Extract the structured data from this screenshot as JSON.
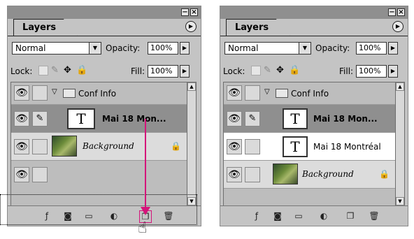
{
  "panels": [
    {
      "tab_label": "Layers",
      "blend_mode": "Normal",
      "opacity_label": "Opacity:",
      "opacity_value": "100%",
      "lock_label": "Lock:",
      "fill_label": "Fill:",
      "fill_value": "100%",
      "layers": [
        {
          "name": "Conf Info",
          "type": "group"
        },
        {
          "name": "Mai 18 Mon...",
          "type": "text",
          "selected": true
        },
        {
          "name": "Background",
          "type": "image",
          "locked": true
        },
        {
          "name": "",
          "type": "empty"
        }
      ]
    },
    {
      "tab_label": "Layers",
      "blend_mode": "Normal",
      "opacity_label": "Opacity:",
      "opacity_value": "100%",
      "lock_label": "Lock:",
      "fill_label": "Fill:",
      "fill_value": "100%",
      "layers": [
        {
          "name": "Conf Info",
          "type": "group"
        },
        {
          "name": "Mai 18 Mon...",
          "type": "text",
          "selected": true
        },
        {
          "name": "Mai 18 Montréal",
          "type": "text"
        },
        {
          "name": "Background",
          "type": "image",
          "locked": true
        }
      ]
    }
  ],
  "icons": {
    "eye": "👁",
    "brush": "✎",
    "move": "✥",
    "lock": "🔒",
    "hand": "☝"
  },
  "colors": {
    "arrow": "#d4147a",
    "selected_row": "#8f8f8f"
  }
}
